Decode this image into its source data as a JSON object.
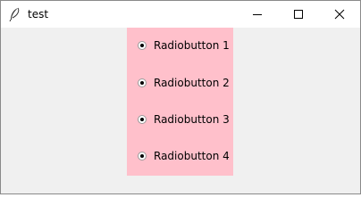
{
  "window": {
    "title": "test",
    "app_icon": "feather-icon",
    "controls": [
      "minimize-icon",
      "maximize-icon",
      "close-icon"
    ]
  },
  "frame": {
    "background": "#ffc0cb",
    "radios": [
      {
        "label": "Radiobutton 1",
        "selected": true
      },
      {
        "label": "Radiobutton 2",
        "selected": true
      },
      {
        "label": "Radiobutton 3",
        "selected": true
      },
      {
        "label": "Radiobutton 4",
        "selected": true
      }
    ]
  }
}
